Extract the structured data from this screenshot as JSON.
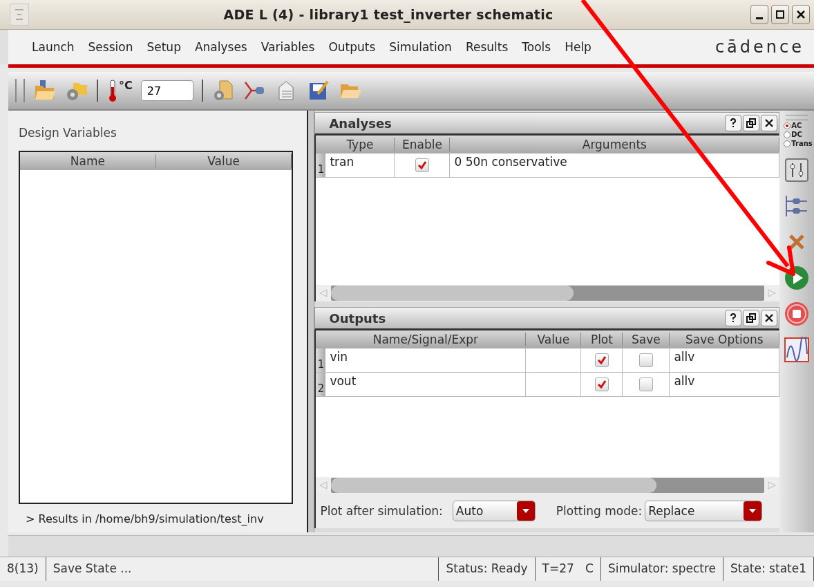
{
  "window": {
    "title": "ADE L (4) - library1 test_inverter schematic"
  },
  "menu": [
    "Launch",
    "Session",
    "Setup",
    "Analyses",
    "Variables",
    "Outputs",
    "Simulation",
    "Results",
    "Tools",
    "Help"
  ],
  "logo": "cādence",
  "toolbar": {
    "temp_unit": "°C",
    "temperature": "27"
  },
  "design_variables": {
    "title": "Design Variables",
    "columns": [
      "Name",
      "Value"
    ],
    "results_path": "> Results in /home/bh9/simulation/test_inv"
  },
  "analyses": {
    "title": "Analyses",
    "columns": [
      "Type",
      "Enable",
      "Arguments"
    ],
    "rows": [
      {
        "index": "1",
        "type": "tran",
        "enabled": true,
        "arguments": "0 50n conservative"
      }
    ]
  },
  "outputs": {
    "title": "Outputs",
    "columns": [
      "Name/Signal/Expr",
      "Value",
      "Plot",
      "Save",
      "Save Options"
    ],
    "rows": [
      {
        "index": "1",
        "name": "vin",
        "plot": true,
        "save": false,
        "save_options": "allv"
      },
      {
        "index": "2",
        "name": "vout",
        "plot": true,
        "save": false,
        "save_options": "allv"
      }
    ]
  },
  "plot_after": {
    "label": "Plot after simulation:",
    "value": "Auto"
  },
  "plotting_mode": {
    "label": "Plotting mode:",
    "value": "Replace"
  },
  "analysis_type": [
    {
      "label": "AC",
      "selected": true
    },
    {
      "label": "DC",
      "selected": false
    },
    {
      "label": "Trans",
      "selected": false
    }
  ],
  "status_bar": [
    "8(13)",
    "Save State ...",
    "Status: Ready",
    "T=27   C",
    "Simulator: spectre",
    "State: state1"
  ]
}
